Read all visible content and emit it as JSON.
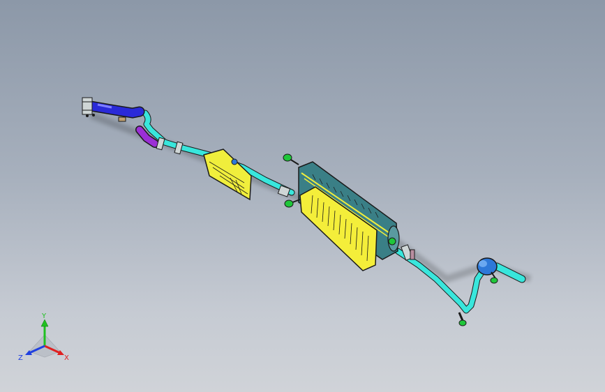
{
  "window": {
    "background_top": "#8c98a8",
    "background_bottom": "#d0d3d8"
  },
  "model": {
    "name": "exhaust-system-assembly",
    "colors": {
      "pipe": "#39e6dc",
      "front_pipe": "#2a2ad8",
      "flex_section": "#9b2fd6",
      "heat_shield": "#f0ee3c",
      "muffler_body": "#3a7f86",
      "muffler_shield": "#f4ee3a",
      "hanger": "#1fc63a",
      "resonator": "#2d78d8",
      "outline": "#1a1a1a"
    }
  },
  "triad": {
    "x_label": "X",
    "y_label": "Y",
    "z_label": "Z",
    "x_color": "#e02020",
    "y_color": "#20c020",
    "z_color": "#2040e0"
  }
}
